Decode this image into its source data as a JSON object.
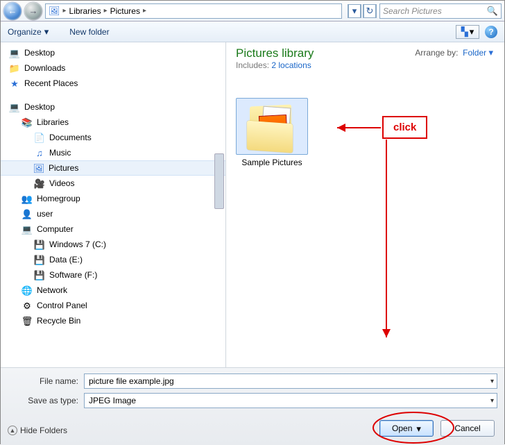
{
  "addressbar": {
    "crumbs": [
      "Libraries",
      "Pictures"
    ],
    "search_placeholder": "Search Pictures"
  },
  "toolbar": {
    "organize": "Organize",
    "new_folder": "New folder"
  },
  "tree": {
    "group1": [
      {
        "name": "desktop",
        "label": "Desktop",
        "icon": "desktop-icon"
      },
      {
        "name": "downloads",
        "label": "Downloads",
        "icon": "folder-icon"
      },
      {
        "name": "recent",
        "label": "Recent Places",
        "icon": "recent-icon"
      }
    ],
    "group2_header": {
      "name": "desktop2",
      "label": "Desktop",
      "icon": "desktop-icon"
    },
    "libraries": {
      "label": "Libraries"
    },
    "lib_children": [
      {
        "name": "documents",
        "label": "Documents",
        "icon": "doc-icon"
      },
      {
        "name": "music",
        "label": "Music",
        "icon": "music-icon"
      },
      {
        "name": "pictures",
        "label": "Pictures",
        "icon": "pictures-icon",
        "selected": true
      },
      {
        "name": "videos",
        "label": "Videos",
        "icon": "video-icon"
      }
    ],
    "group3": [
      {
        "name": "homegroup",
        "label": "Homegroup",
        "icon": "homegroup-icon"
      },
      {
        "name": "user",
        "label": "user",
        "icon": "user-icon"
      },
      {
        "name": "computer",
        "label": "Computer",
        "icon": "computer-icon"
      }
    ],
    "drives": [
      {
        "name": "drive-c",
        "label": "Windows 7 (C:)",
        "icon": "drive-icon"
      },
      {
        "name": "drive-e",
        "label": "Data (E:)",
        "icon": "drive-icon"
      },
      {
        "name": "drive-f",
        "label": "Software (F:)",
        "icon": "drive-icon"
      }
    ],
    "group4": [
      {
        "name": "network",
        "label": "Network",
        "icon": "network-icon"
      },
      {
        "name": "controlpanel",
        "label": "Control Panel",
        "icon": "cpl-icon"
      },
      {
        "name": "recycle",
        "label": "Recycle Bin",
        "icon": "recycle-icon"
      }
    ]
  },
  "content": {
    "title": "Pictures library",
    "includes_prefix": "Includes:",
    "includes_link": "2 locations",
    "arrange_prefix": "Arrange by:",
    "arrange_value": "Folder",
    "thumbs": [
      {
        "name": "sample-pictures",
        "label": "Sample Pictures",
        "selected": true
      }
    ]
  },
  "bottom": {
    "file_name_label": "File name:",
    "file_name_value": "picture file example.jpg",
    "save_type_label": "Save as type:",
    "save_type_value": "JPEG Image",
    "hide_folders": "Hide Folders",
    "open": "Open",
    "cancel": "Cancel"
  },
  "annotation": {
    "label": "click"
  }
}
